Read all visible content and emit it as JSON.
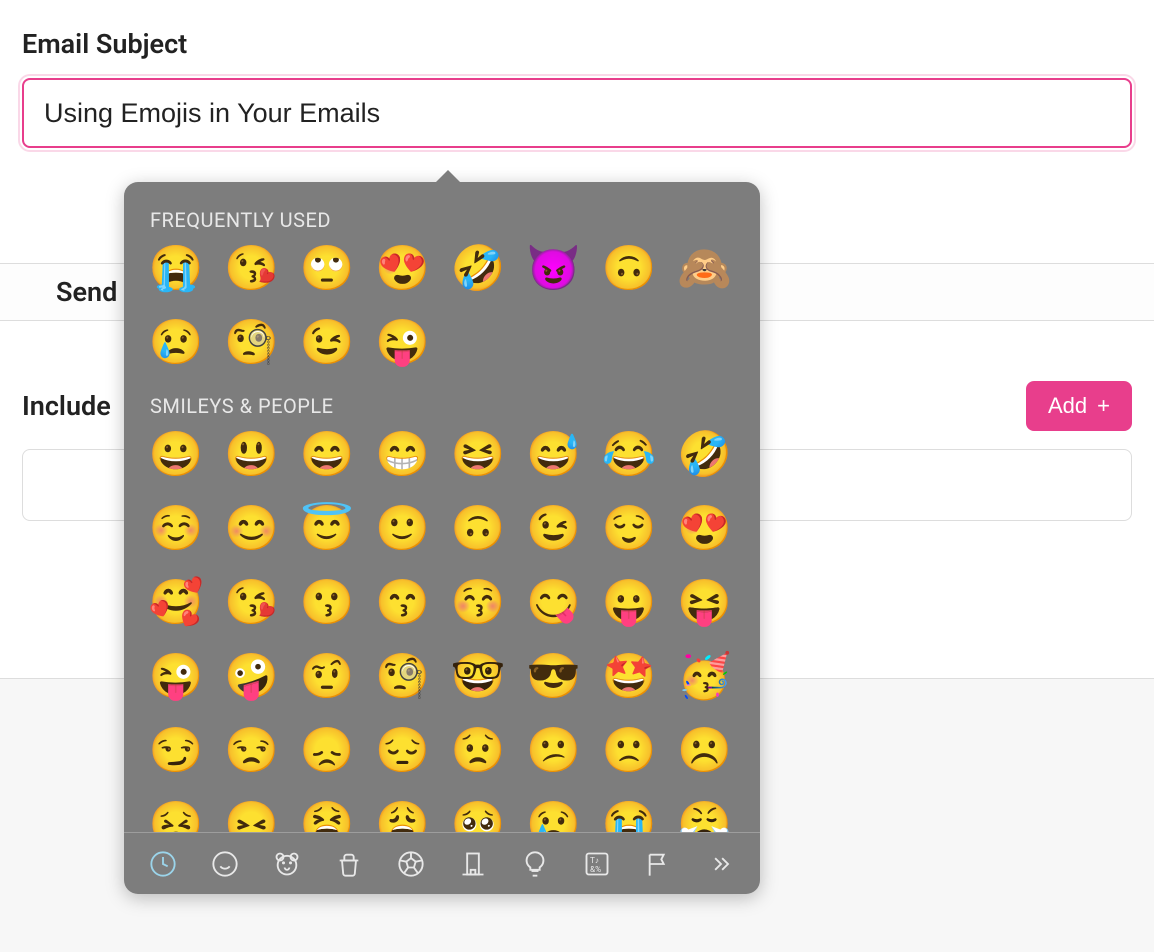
{
  "form": {
    "subject_label": "Email Subject",
    "subject_value": "Using Emojis in Your Emails",
    "send_label": "Send",
    "include_label": "Include",
    "add_button_label": "Add"
  },
  "picker": {
    "sections": {
      "frequently_used": {
        "title": "FREQUENTLY USED",
        "emojis": [
          "😭",
          "😘",
          "🙄",
          "😍",
          "🤣",
          "😈",
          "🙃",
          "🙈",
          "😢",
          "🧐",
          "😉",
          "😜"
        ]
      },
      "smileys_people": {
        "title": "SMILEYS & PEOPLE",
        "emojis": [
          "😀",
          "😃",
          "😄",
          "😁",
          "😆",
          "😅",
          "😂",
          "🤣",
          "☺️",
          "😊",
          "😇",
          "🙂",
          "🙃",
          "😉",
          "😌",
          "😍",
          "🥰",
          "😘",
          "😗",
          "😙",
          "😚",
          "😋",
          "😛",
          "😝",
          "😜",
          "🤪",
          "🤨",
          "🧐",
          "🤓",
          "😎",
          "🤩",
          "🥳",
          "😏",
          "😒",
          "😞",
          "😔",
          "😟",
          "😕",
          "🙁",
          "☹️",
          "😣",
          "😖",
          "😫",
          "😩",
          "🥺",
          "😢",
          "😭",
          "😤"
        ]
      }
    },
    "tabs": [
      {
        "name": "frequently-used",
        "icon": "clock"
      },
      {
        "name": "smileys-people",
        "icon": "smile"
      },
      {
        "name": "animals-nature",
        "icon": "bear"
      },
      {
        "name": "food-drink",
        "icon": "cup"
      },
      {
        "name": "activity",
        "icon": "soccer"
      },
      {
        "name": "travel-places",
        "icon": "building"
      },
      {
        "name": "objects",
        "icon": "lightbulb"
      },
      {
        "name": "symbols",
        "icon": "symbols"
      },
      {
        "name": "flags",
        "icon": "flag"
      },
      {
        "name": "more",
        "icon": "chevrons"
      }
    ]
  }
}
